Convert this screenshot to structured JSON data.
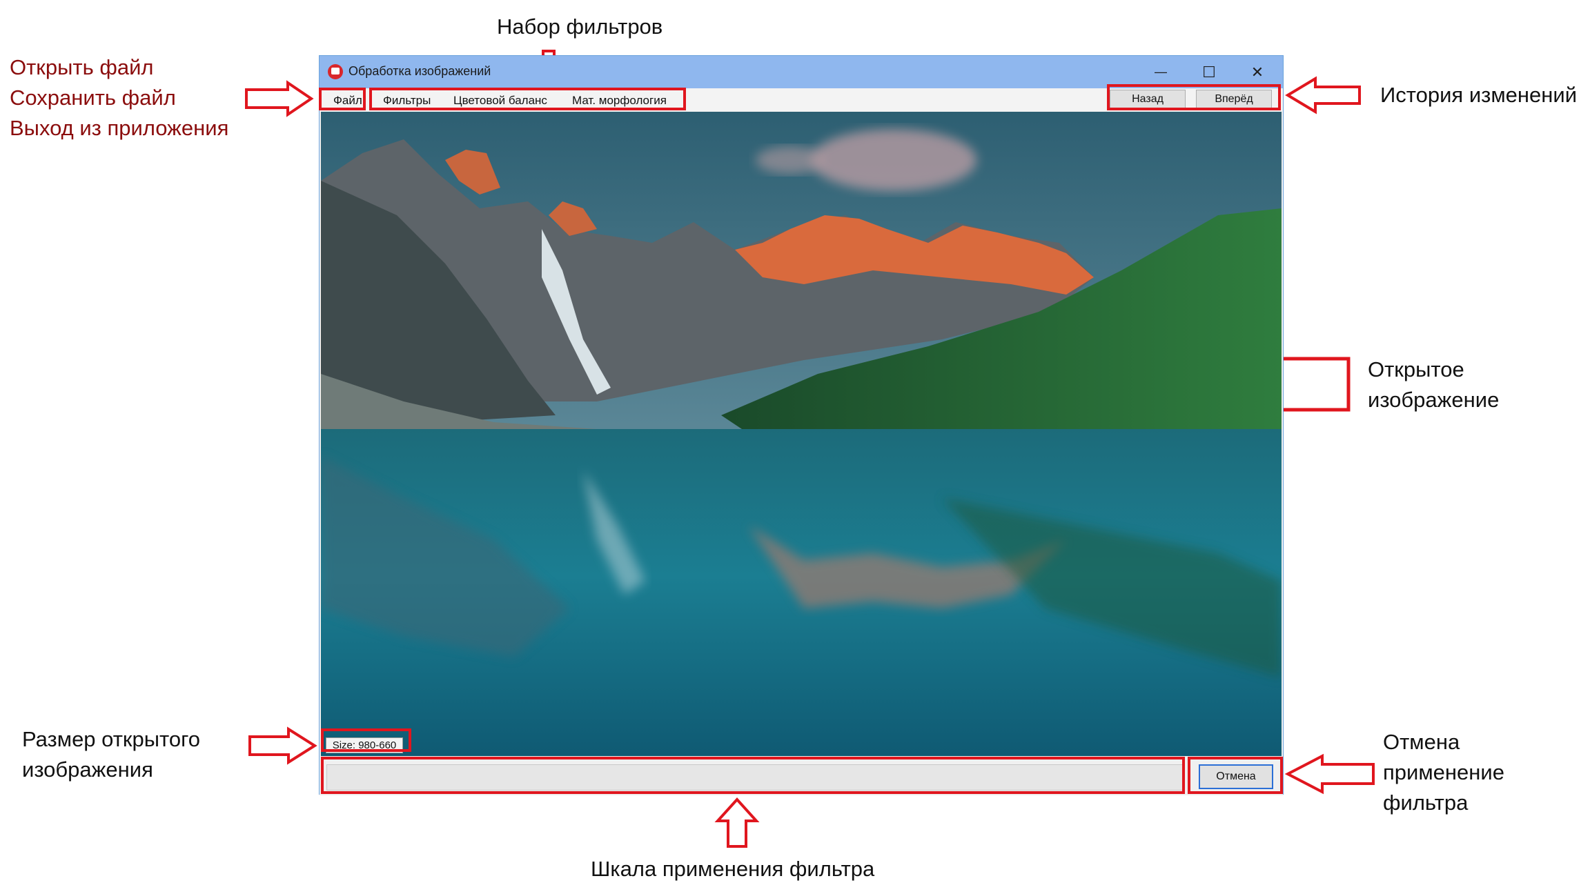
{
  "annotations": {
    "file_menu_items": [
      "Открыть файл",
      "Сохранить файл",
      "Выход из приложения"
    ],
    "filter_set": "Набор фильтров",
    "history": "История изменений",
    "opened_image": [
      "Открытое",
      "изображение"
    ],
    "image_size": [
      "Размер открытого",
      "изображения"
    ],
    "cancel_filter": [
      "Отмена",
      "применение",
      "фильтра"
    ],
    "filter_scale": "Шкала применения фильтра"
  },
  "window": {
    "title": "Обработка изображений",
    "minimize_glyph": "—",
    "maximize_glyph": "☐",
    "close_glyph": "✕",
    "menu": [
      "Файл",
      "Фильтры",
      "Цветовой баланс",
      "Мат. морфология"
    ],
    "back_label": "Назад",
    "forward_label": "Вперёд",
    "size_label": "Size: 980-660",
    "cancel_label": "Отмена"
  },
  "colors": {
    "annotation_red": "#e0161e",
    "file_text": "#8b0d0d",
    "titlebar": "#8fb7ee"
  }
}
